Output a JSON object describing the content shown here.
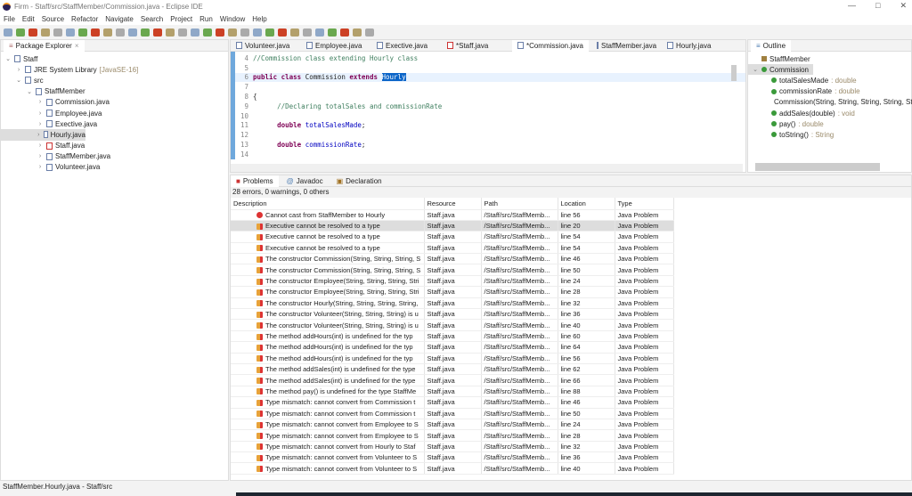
{
  "window": {
    "title": "Firm - Staff/src/StaffMember/Commission.java - Eclipse IDE"
  },
  "menu": [
    "File",
    "Edit",
    "Source",
    "Refactor",
    "Navigate",
    "Search",
    "Project",
    "Run",
    "Window",
    "Help"
  ],
  "package_explorer": {
    "title": "Package Explorer",
    "items": [
      {
        "label": "Staff",
        "level": 0,
        "chev": "v"
      },
      {
        "label": "JRE System Library",
        "suffix": "[JavaSE-16]",
        "level": 1,
        "chev": ">"
      },
      {
        "label": "src",
        "level": 1,
        "chev": "v"
      },
      {
        "label": "StaffMember",
        "level": 2,
        "chev": "v"
      },
      {
        "label": "Commission.java",
        "level": 3,
        "chev": ">"
      },
      {
        "label": "Employee.java",
        "level": 3,
        "chev": ">"
      },
      {
        "label": "Exective.java",
        "level": 3,
        "chev": ">"
      },
      {
        "label": "Hourly.java",
        "level": 3,
        "chev": ">",
        "selected": true
      },
      {
        "label": "Staff.java",
        "level": 3,
        "chev": ">",
        "error": true
      },
      {
        "label": "StaffMember.java",
        "level": 3,
        "chev": ">"
      },
      {
        "label": "Volunteer.java",
        "level": 3,
        "chev": ">"
      }
    ]
  },
  "editor": {
    "tabs": [
      {
        "label": "Volunteer.java"
      },
      {
        "label": "Employee.java"
      },
      {
        "label": "Exective.java"
      },
      {
        "label": "*Staff.java",
        "error": true
      },
      {
        "label": "*Commission.java",
        "active": true
      },
      {
        "label": "StaffMember.java"
      },
      {
        "label": "Hourly.java"
      }
    ],
    "lines": [
      {
        "n": "4",
        "parts": [
          {
            "t": "//Commission class extending Hourly class",
            "c": "cmt"
          }
        ]
      },
      {
        "n": "5",
        "parts": []
      },
      {
        "n": "6",
        "hl": true,
        "parts": [
          {
            "t": "public class ",
            "c": "kw"
          },
          {
            "t": "Commission ",
            "c": ""
          },
          {
            "t": "extends ",
            "c": "kw"
          },
          {
            "t": "Hourly",
            "c": "selw"
          }
        ]
      },
      {
        "n": "7",
        "parts": []
      },
      {
        "n": "8",
        "parts": [
          {
            "t": "{",
            "c": ""
          }
        ]
      },
      {
        "n": "9",
        "parts": [
          {
            "t": "      //Declaring totalSales and commissionRate",
            "c": "cmt"
          }
        ]
      },
      {
        "n": "10",
        "parts": []
      },
      {
        "n": "11",
        "parts": [
          {
            "t": "      double ",
            "c": "kw"
          },
          {
            "t": "totalSalesMade",
            "c": "fld"
          },
          {
            "t": ";",
            "c": ""
          }
        ]
      },
      {
        "n": "12",
        "parts": []
      },
      {
        "n": "13",
        "parts": [
          {
            "t": "      double ",
            "c": "kw"
          },
          {
            "t": "commissionRate",
            "c": "fld"
          },
          {
            "t": ";",
            "c": ""
          }
        ]
      },
      {
        "n": "14",
        "parts": []
      }
    ]
  },
  "outline": {
    "title": "Outline",
    "items": [
      {
        "label": "StaffMember",
        "level": 0
      },
      {
        "label": "Commission",
        "level": 0,
        "chev": "v",
        "selected": true
      },
      {
        "label": "totalSalesMade",
        "type": " : double",
        "level": 1
      },
      {
        "label": "commissionRate",
        "type": " : double",
        "level": 1
      },
      {
        "label": "Commission(String, String, String, String, String,",
        "type": "",
        "level": 1
      },
      {
        "label": "addSales(double)",
        "type": " : void",
        "level": 1
      },
      {
        "label": "pay()",
        "type": " : double",
        "level": 1
      },
      {
        "label": "toString()",
        "type": " : String",
        "level": 1
      }
    ]
  },
  "problems": {
    "tabs": [
      "Problems",
      "Javadoc",
      "Declaration"
    ],
    "summary": "28 errors, 0 warnings, 0 others",
    "columns": [
      "Description",
      "Resource",
      "Path",
      "Location",
      "Type"
    ],
    "rows": [
      {
        "d": "Cannot cast from StaffMember to Hourly",
        "r": "Staff.java",
        "p": "/Staff/src/StaffMemb...",
        "l": "line 56",
        "t": "Java Problem",
        "kind": "error"
      },
      {
        "d": "Executive cannot be resolved to a type",
        "r": "Staff.java",
        "p": "/Staff/src/StaffMemb...",
        "l": "line 20",
        "t": "Java Problem",
        "sel": true
      },
      {
        "d": "Executive cannot be resolved to a type",
        "r": "Staff.java",
        "p": "/Staff/src/StaffMemb...",
        "l": "line 54",
        "t": "Java Problem"
      },
      {
        "d": "Executive cannot be resolved to a type",
        "r": "Staff.java",
        "p": "/Staff/src/StaffMemb...",
        "l": "line 54",
        "t": "Java Problem"
      },
      {
        "d": "The constructor Commission(String, String, String, S",
        "r": "Staff.java",
        "p": "/Staff/src/StaffMemb...",
        "l": "line 46",
        "t": "Java Problem"
      },
      {
        "d": "The constructor Commission(String, String, String, S",
        "r": "Staff.java",
        "p": "/Staff/src/StaffMemb...",
        "l": "line 50",
        "t": "Java Problem"
      },
      {
        "d": "The constructor Employee(String, String, String, Stri",
        "r": "Staff.java",
        "p": "/Staff/src/StaffMemb...",
        "l": "line 24",
        "t": "Java Problem"
      },
      {
        "d": "The constructor Employee(String, String, String, Stri",
        "r": "Staff.java",
        "p": "/Staff/src/StaffMemb...",
        "l": "line 28",
        "t": "Java Problem"
      },
      {
        "d": "The constructor Hourly(String, String, String, String,",
        "r": "Staff.java",
        "p": "/Staff/src/StaffMemb...",
        "l": "line 32",
        "t": "Java Problem"
      },
      {
        "d": "The constructor Volunteer(String, String, String) is u",
        "r": "Staff.java",
        "p": "/Staff/src/StaffMemb...",
        "l": "line 36",
        "t": "Java Problem"
      },
      {
        "d": "The constructor Volunteer(String, String, String) is u",
        "r": "Staff.java",
        "p": "/Staff/src/StaffMemb...",
        "l": "line 40",
        "t": "Java Problem"
      },
      {
        "d": "The method addHours(int) is undefined for the typ",
        "r": "Staff.java",
        "p": "/Staff/src/StaffMemb...",
        "l": "line 60",
        "t": "Java Problem"
      },
      {
        "d": "The method addHours(int) is undefined for the typ",
        "r": "Staff.java",
        "p": "/Staff/src/StaffMemb...",
        "l": "line 64",
        "t": "Java Problem"
      },
      {
        "d": "The method addHours(int) is undefined for the typ",
        "r": "Staff.java",
        "p": "/Staff/src/StaffMemb...",
        "l": "line 56",
        "t": "Java Problem"
      },
      {
        "d": "The method addSales(int) is undefined for the type",
        "r": "Staff.java",
        "p": "/Staff/src/StaffMemb...",
        "l": "line 62",
        "t": "Java Problem"
      },
      {
        "d": "The method addSales(int) is undefined for the type",
        "r": "Staff.java",
        "p": "/Staff/src/StaffMemb...",
        "l": "line 66",
        "t": "Java Problem"
      },
      {
        "d": "The method pay() is undefined for the type StaffMe",
        "r": "Staff.java",
        "p": "/Staff/src/StaffMemb...",
        "l": "line 88",
        "t": "Java Problem"
      },
      {
        "d": "Type mismatch: cannot convert from Commission t",
        "r": "Staff.java",
        "p": "/Staff/src/StaffMemb...",
        "l": "line 46",
        "t": "Java Problem"
      },
      {
        "d": "Type mismatch: cannot convert from Commission t",
        "r": "Staff.java",
        "p": "/Staff/src/StaffMemb...",
        "l": "line 50",
        "t": "Java Problem"
      },
      {
        "d": "Type mismatch: cannot convert from Employee to S",
        "r": "Staff.java",
        "p": "/Staff/src/StaffMemb...",
        "l": "line 24",
        "t": "Java Problem"
      },
      {
        "d": "Type mismatch: cannot convert from Employee to S",
        "r": "Staff.java",
        "p": "/Staff/src/StaffMemb...",
        "l": "line 28",
        "t": "Java Problem"
      },
      {
        "d": "Type mismatch: cannot convert from Hourly to Staf",
        "r": "Staff.java",
        "p": "/Staff/src/StaffMemb...",
        "l": "line 32",
        "t": "Java Problem"
      },
      {
        "d": "Type mismatch: cannot convert from Volunteer to S",
        "r": "Staff.java",
        "p": "/Staff/src/StaffMemb...",
        "l": "line 36",
        "t": "Java Problem"
      },
      {
        "d": "Type mismatch: cannot convert from Volunteer to S",
        "r": "Staff.java",
        "p": "/Staff/src/StaffMemb...",
        "l": "line 40",
        "t": "Java Problem"
      }
    ]
  },
  "status": {
    "text": "StaffMember.Hourly.java - Staff/src"
  }
}
